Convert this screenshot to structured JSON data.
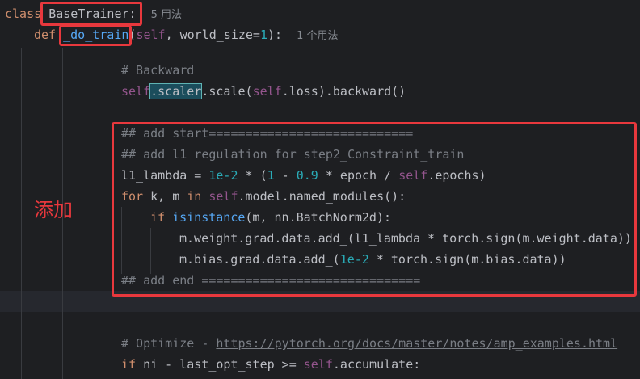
{
  "editor": {
    "line1": {
      "kw": "class",
      "name": "BaseTrainer:",
      "hint": "5 用法"
    },
    "line2": {
      "kw": "def",
      "name": "_do_train",
      "open": "(",
      "self": "self",
      "rest": ", world_size=",
      "num": "1",
      "close": "):",
      "hint": "1 个用法"
    },
    "backward_comment": "# Backward",
    "backward": {
      "self": "self",
      "scaler": ".scaler",
      "rest1": ".scale(",
      "self2": "self",
      "rest2": ".loss).backward()"
    },
    "add_start": "## add start============================",
    "add_l1": "## add l1 regulation for step2_Constraint_train",
    "lambda": {
      "a": "l1_lambda = ",
      "n1": "1e-2",
      "b": " * (",
      "n2": "1",
      "c": " - ",
      "n3": "0.9",
      "d": " * epoch / ",
      "self": "self",
      "e": ".epochs)"
    },
    "for": {
      "kw": "for",
      "a": " k, m ",
      "kw2": "in",
      "sp": " ",
      "self": "self",
      "b": ".model.named_modules():"
    },
    "if": {
      "kw": "if",
      "sp": " ",
      "fn": "isinstance",
      "a": "(m, nn.BatchNorm2d):"
    },
    "weight_line": "m.weight.grad.data.add_(l1_lambda * torch.sign(m.weight.data))",
    "bias": {
      "a": "m.bias.grad.data.add_(",
      "n": "1e-2",
      "b": " * torch.sign(m.bias.data))"
    },
    "add_end": "## add end ==============================",
    "optimize": {
      "c": "# Optimize - ",
      "url": "https://pytorch.org/docs/master/notes/amp_examples.html"
    },
    "ifni": {
      "kw": "if",
      "a": " ni - last_opt_step >= ",
      "self": "self",
      "b": ".accumulate:"
    }
  },
  "annotation": {
    "label": "添加"
  },
  "colors": {
    "annotation_red": "#e8383d",
    "background": "#1e1f22",
    "keyword": "#cf8e6d",
    "self": "#94558d",
    "number": "#2aacb8",
    "comment": "#7a7e85"
  }
}
